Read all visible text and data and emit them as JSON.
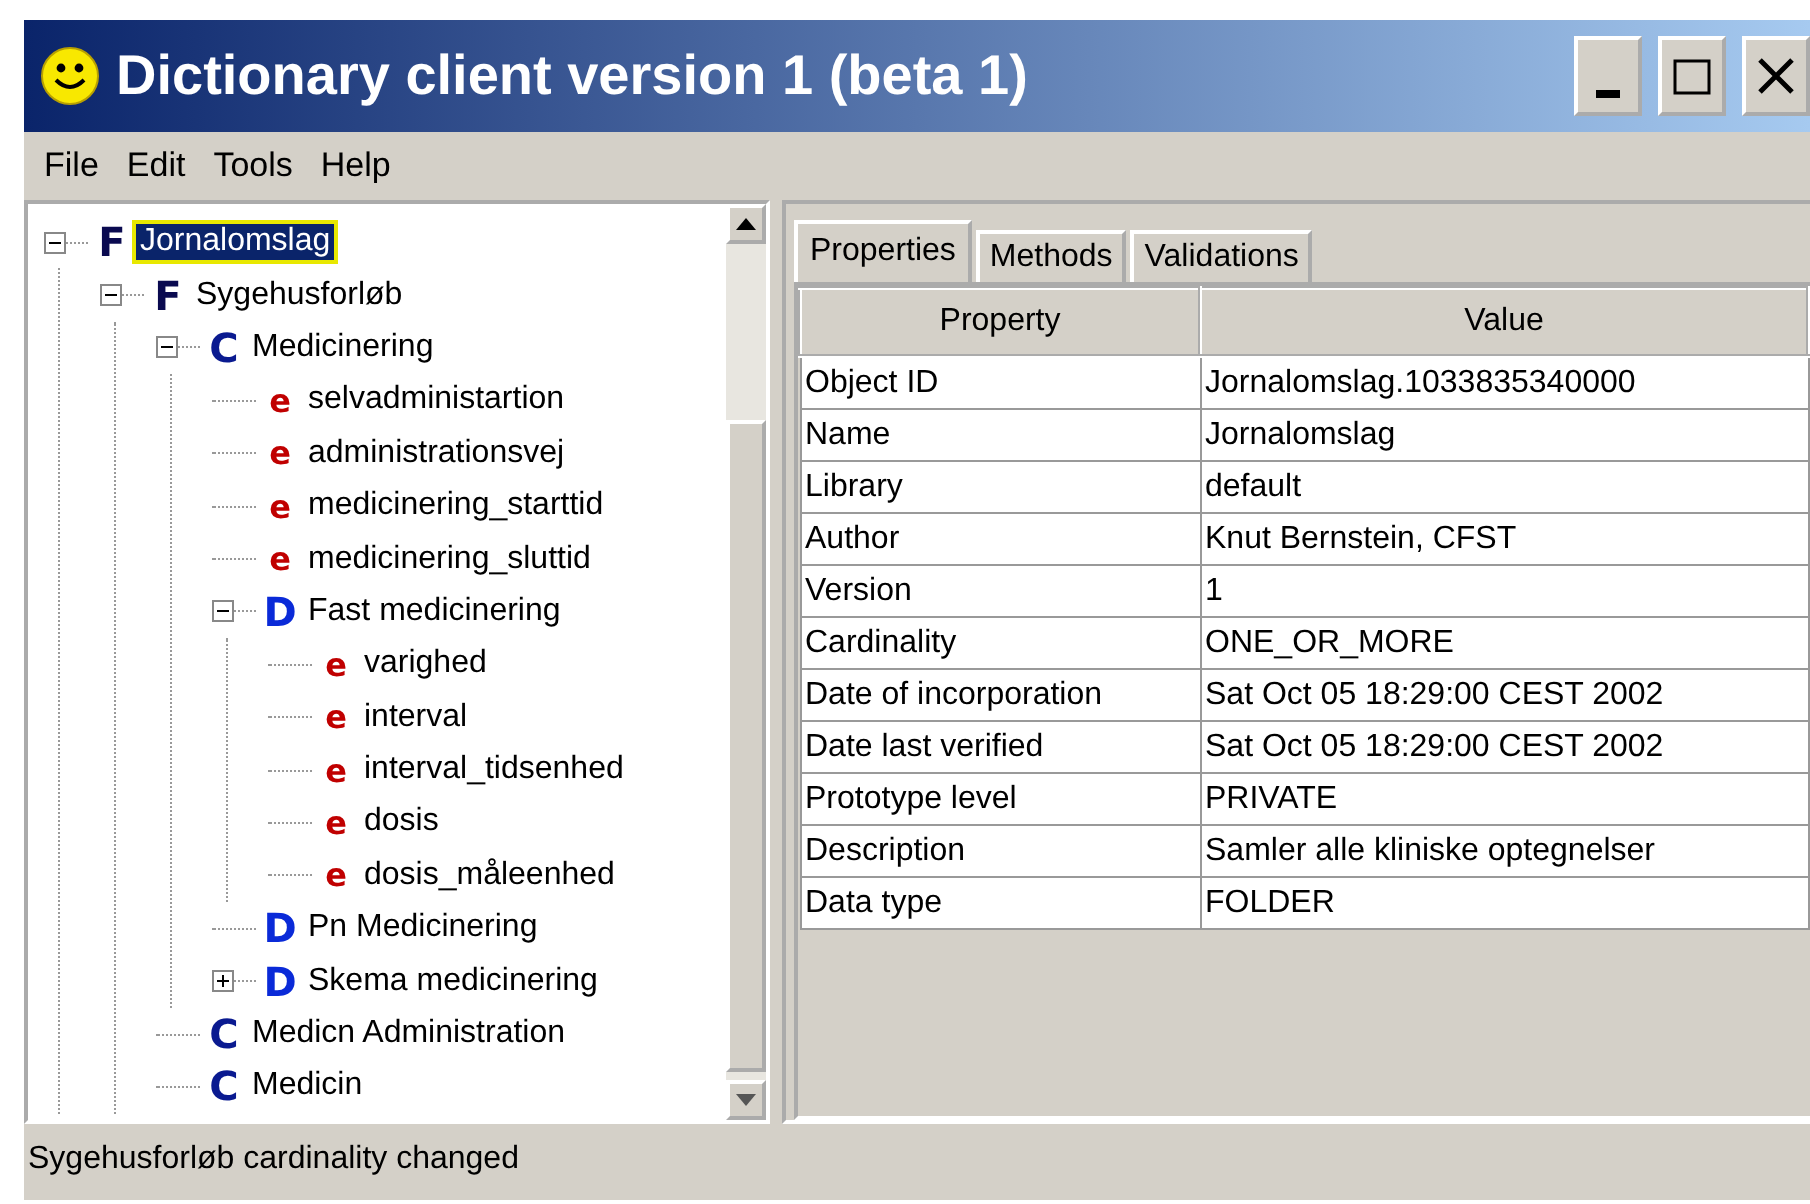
{
  "window": {
    "title": "Dictionary client version 1 (beta 1)"
  },
  "menu": [
    "File",
    "Edit",
    "Tools",
    "Help"
  ],
  "tree": [
    {
      "kind": "folder",
      "icon": "F",
      "label": "Jornalomslag",
      "selected": true,
      "expanded": true,
      "children": [
        {
          "kind": "folder",
          "icon": "F",
          "label": "Sygehusforløb",
          "selected": false,
          "expanded": true,
          "children": [
            {
              "kind": "class",
              "icon": "C",
              "label": "Medicinering",
              "selected": false,
              "expanded": true,
              "children": [
                {
                  "kind": "element",
                  "icon": "e",
                  "label": "selvadministartion",
                  "selected": false
                },
                {
                  "kind": "element",
                  "icon": "e",
                  "label": "administrationsvej",
                  "selected": false
                },
                {
                  "kind": "element",
                  "icon": "e",
                  "label": "medicinering_starttid",
                  "selected": false
                },
                {
                  "kind": "element",
                  "icon": "e",
                  "label": "medicinering_sluttid",
                  "selected": false
                },
                {
                  "kind": "domain",
                  "icon": "D",
                  "label": "Fast medicinering",
                  "selected": false,
                  "expanded": true,
                  "children": [
                    {
                      "kind": "element",
                      "icon": "e",
                      "label": "varighed",
                      "selected": false
                    },
                    {
                      "kind": "element",
                      "icon": "e",
                      "label": "interval",
                      "selected": false
                    },
                    {
                      "kind": "element",
                      "icon": "e",
                      "label": "interval_tidsenhed",
                      "selected": false
                    },
                    {
                      "kind": "element",
                      "icon": "e",
                      "label": "dosis",
                      "selected": false
                    },
                    {
                      "kind": "element",
                      "icon": "e",
                      "label": "dosis_måleenhed",
                      "selected": false
                    }
                  ]
                },
                {
                  "kind": "domain",
                  "icon": "D",
                  "label": "Pn Medicinering",
                  "selected": false
                },
                {
                  "kind": "domain",
                  "icon": "D",
                  "label": "Skema medicinering",
                  "selected": false,
                  "expanded": false
                }
              ]
            },
            {
              "kind": "class",
              "icon": "C",
              "label": "Medicn Administration",
              "selected": false
            },
            {
              "kind": "class",
              "icon": "C",
              "label": "Medicin",
              "selected": false
            }
          ]
        }
      ]
    }
  ],
  "tabs": [
    {
      "label": "Properties",
      "selected": true
    },
    {
      "label": "Methods",
      "selected": false
    },
    {
      "label": "Validations",
      "selected": false
    }
  ],
  "table": {
    "columns": [
      "Property",
      "Value"
    ],
    "rows": [
      [
        "Object ID",
        "Jornalomslag.1033835340000"
      ],
      [
        "Name",
        "Jornalomslag"
      ],
      [
        "Library",
        "default"
      ],
      [
        "Author",
        "Knut Bernstein, CFST"
      ],
      [
        "Version",
        "1"
      ],
      [
        "Cardinality",
        "ONE_OR_MORE"
      ],
      [
        "Date of incorporation",
        "Sat Oct 05 18:29:00 CEST 2002"
      ],
      [
        "Date last verified",
        "Sat Oct 05 18:29:00 CEST 2002"
      ],
      [
        "Prototype level",
        "PRIVATE"
      ],
      [
        "Description",
        "Samler alle kliniske optegnelser"
      ],
      [
        "Data type",
        "FOLDER"
      ]
    ]
  },
  "status_bar": "Sygehusforløb cardinality changed"
}
